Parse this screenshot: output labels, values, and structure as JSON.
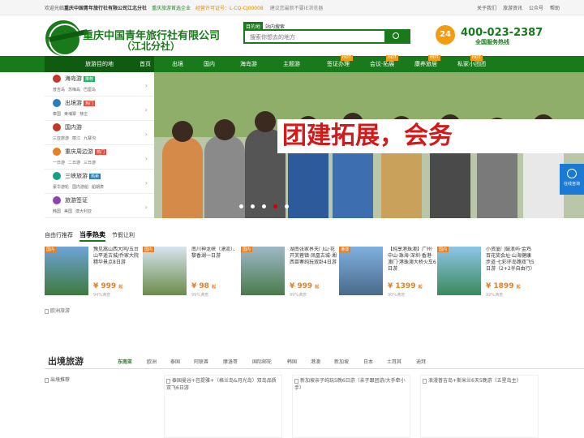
{
  "topbar": {
    "welcome": "欢迎光临",
    "company": "重庆中国青年旅行社有限公司江北分社",
    "tagline": "重庆旅游首选企业",
    "license": "经营许可证号：L-CQ-CJ00008",
    "tip": "建议您最新不要IE浏览器",
    "links": [
      "关于我们",
      "旅游资讯",
      "公众号",
      "帮助"
    ]
  },
  "header": {
    "title_line1": "重庆中国青年旅行社有限公司",
    "title_line2": "（江北分社）",
    "search_tabs": [
      "目的地",
      "站内搜索"
    ],
    "search_placeholder": "搜索你想去的地方",
    "hotline_badge": "24",
    "phone": "400-023-2387",
    "phone_sub": "全国服务热线"
  },
  "nav": {
    "first": "旅游目的地",
    "items": [
      "首页",
      "出境",
      "国内",
      "海岛游",
      "主题游",
      "签证办理",
      "会议·拓展",
      "康养旅居",
      "私家小团团"
    ],
    "tags": [
      "HOT",
      "HOT",
      "HOT",
      "HOT"
    ]
  },
  "categories": [
    {
      "name": "海岛游",
      "badge": "推荐",
      "subs": [
        "普吉岛",
        "苏梅岛",
        "巴厘岛"
      ]
    },
    {
      "name": "出境游",
      "badge": "热门",
      "subs": [
        "泰国",
        "柬埔寨",
        "芽庄"
      ]
    },
    {
      "name": "国内游",
      "badge": "",
      "subs": [
        "三亚旅游",
        "丽江",
        "九寨沟"
      ]
    },
    {
      "name": "重庆周边游",
      "badge": "热门",
      "subs": [
        "一日游",
        "二日游",
        "三日游"
      ]
    },
    {
      "name": "三峡旅游",
      "badge": "热卖",
      "subs": [
        "豪华游轮",
        "国内游船",
        "船期表"
      ]
    },
    {
      "name": "旅游签证",
      "badge": "",
      "subs": [
        "韩国",
        "美国",
        "澳大利亚"
      ]
    }
  ],
  "banner": {
    "title": "团建拓展，会务"
  },
  "side_service": {
    "label": "在线咨询"
  },
  "tabs1": [
    "自由行推荐",
    "当季热卖",
    "节假让利"
  ],
  "products": [
    {
      "label": "国内",
      "title": "豫见嵩山西大同/五台山平遥古城/乔家大院精华景点8日游",
      "price": "999",
      "unit": "起",
      "sat": "94%满意"
    },
    {
      "label": "国内",
      "title": "南川神龙峡（漂流）、黎香湖一日游",
      "price": "98",
      "unit": "起",
      "sat": "99%满意"
    },
    {
      "label": "国内",
      "title": "湖南张家界天门山·花开芙蓉镇·凤凰古城·湘西苗寨纯玩双卧4日游",
      "price": "999",
      "unit": "起",
      "sat": "99%满意"
    },
    {
      "label": "港澳",
      "title": "【纯享港珠澳】广州·中山·珠海·深圳·香港·澳门·港珠澳大桥火车6日游",
      "price": "1399",
      "unit": "起",
      "sat": "90%满意"
    },
    {
      "label": "国内",
      "title": "小资厦门鼓浪屿·金鸡百花奖会址·山海健康步道·七彩环岛路双飞5日游（2+2半自由行）",
      "price": "1899",
      "unit": "起",
      "sat": "92%满意"
    }
  ],
  "broken1": "欧洲旅游",
  "section2": {
    "title": "出境旅游",
    "tabs": [
      "东南亚",
      "欧洲",
      "泰国",
      "阿联酋",
      "摩洛哥",
      "国际邮轮",
      "韩国",
      "港澳",
      "新加坡",
      "日本",
      "土耳其",
      "迪拜"
    ]
  },
  "cards": [
    {
      "alt": "出境推荐"
    },
    {
      "alt": "泰国曼谷+芭提雅+（格兰岛&月光岛）双岛品质双飞6日游"
    },
    {
      "alt": "新加坡亲子纯玩5晚6日游（亲子跟团游/大手牵小手）"
    },
    {
      "alt": "浪漫普吉岛+斯米兰6天5晚游（五星岛主）"
    }
  ]
}
